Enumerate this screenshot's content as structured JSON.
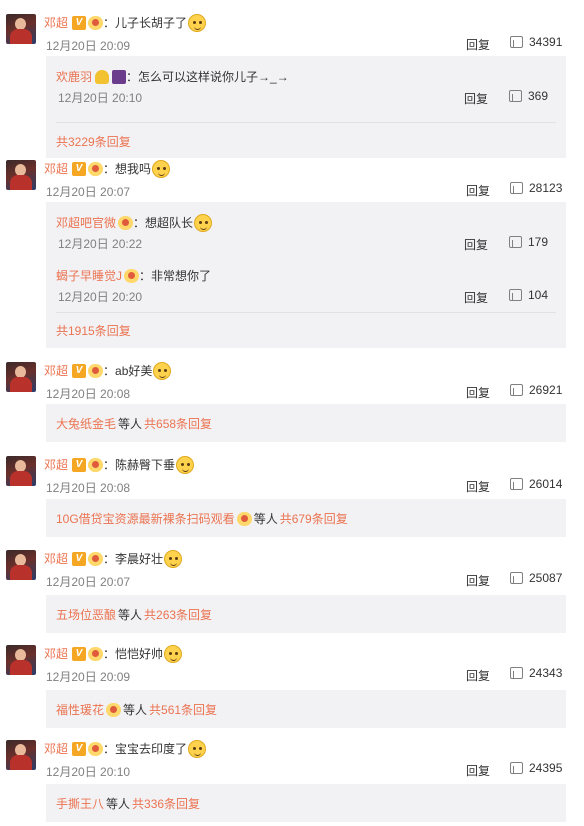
{
  "ui": {
    "reply_label": "回复",
    "accent_color": "#eb7350",
    "icons": {
      "verified": "V",
      "like": "thumb-up-icon"
    }
  },
  "comments": [
    {
      "user": "邓超",
      "text": "：儿子长胡子了",
      "time": "12月20日 20:09",
      "likes": "34391",
      "replies": [
        {
          "user": "欢鹿羽",
          "text": "：怎么可以这样说你儿子→_→",
          "time": "12月20日 20:10",
          "likes": "369"
        }
      ],
      "total": "共3229条回复"
    },
    {
      "user": "邓超",
      "text": "：想我吗",
      "time": "12月20日 20:07",
      "likes": "28123",
      "replies": [
        {
          "user": "邓超吧官微",
          "text": "：想超队长",
          "time": "12月20日 20:22",
          "likes": "179"
        },
        {
          "user": "蝎子早睡觉J",
          "text": "：非常想你了",
          "time": "12月20日 20:20",
          "likes": "104"
        }
      ],
      "total": "共1915条回复"
    },
    {
      "user": "邓超",
      "text": "：ab好美",
      "time": "12月20日 20:08",
      "likes": "26921",
      "summary": {
        "name": "大兔纸金毛",
        "mid": "等人",
        "total": "共658条回复"
      }
    },
    {
      "user": "邓超",
      "text": "：陈赫臀下垂",
      "time": "12月20日 20:08",
      "likes": "26014",
      "summary": {
        "name": "10G借贷宝资源最新裸条扫码观看",
        "mid": "等人",
        "total": "共679条回复"
      }
    },
    {
      "user": "邓超",
      "text": "：李晨好壮",
      "time": "12月20日 20:07",
      "likes": "25087",
      "summary": {
        "name": "五场位恶酿",
        "mid": "等人",
        "total": "共263条回复"
      }
    },
    {
      "user": "邓超",
      "text": "：恺恺好帅",
      "time": "12月20日 20:09",
      "likes": "24343",
      "summary": {
        "name": "福性瑗花",
        "mid": "等人",
        "total": "共561条回复"
      }
    },
    {
      "user": "邓超",
      "text": "：宝宝去印度了",
      "time": "12月20日 20:10",
      "likes": "24395",
      "summary": {
        "name": "手撕王八",
        "mid": "等人",
        "total": "共336条回复"
      }
    }
  ]
}
